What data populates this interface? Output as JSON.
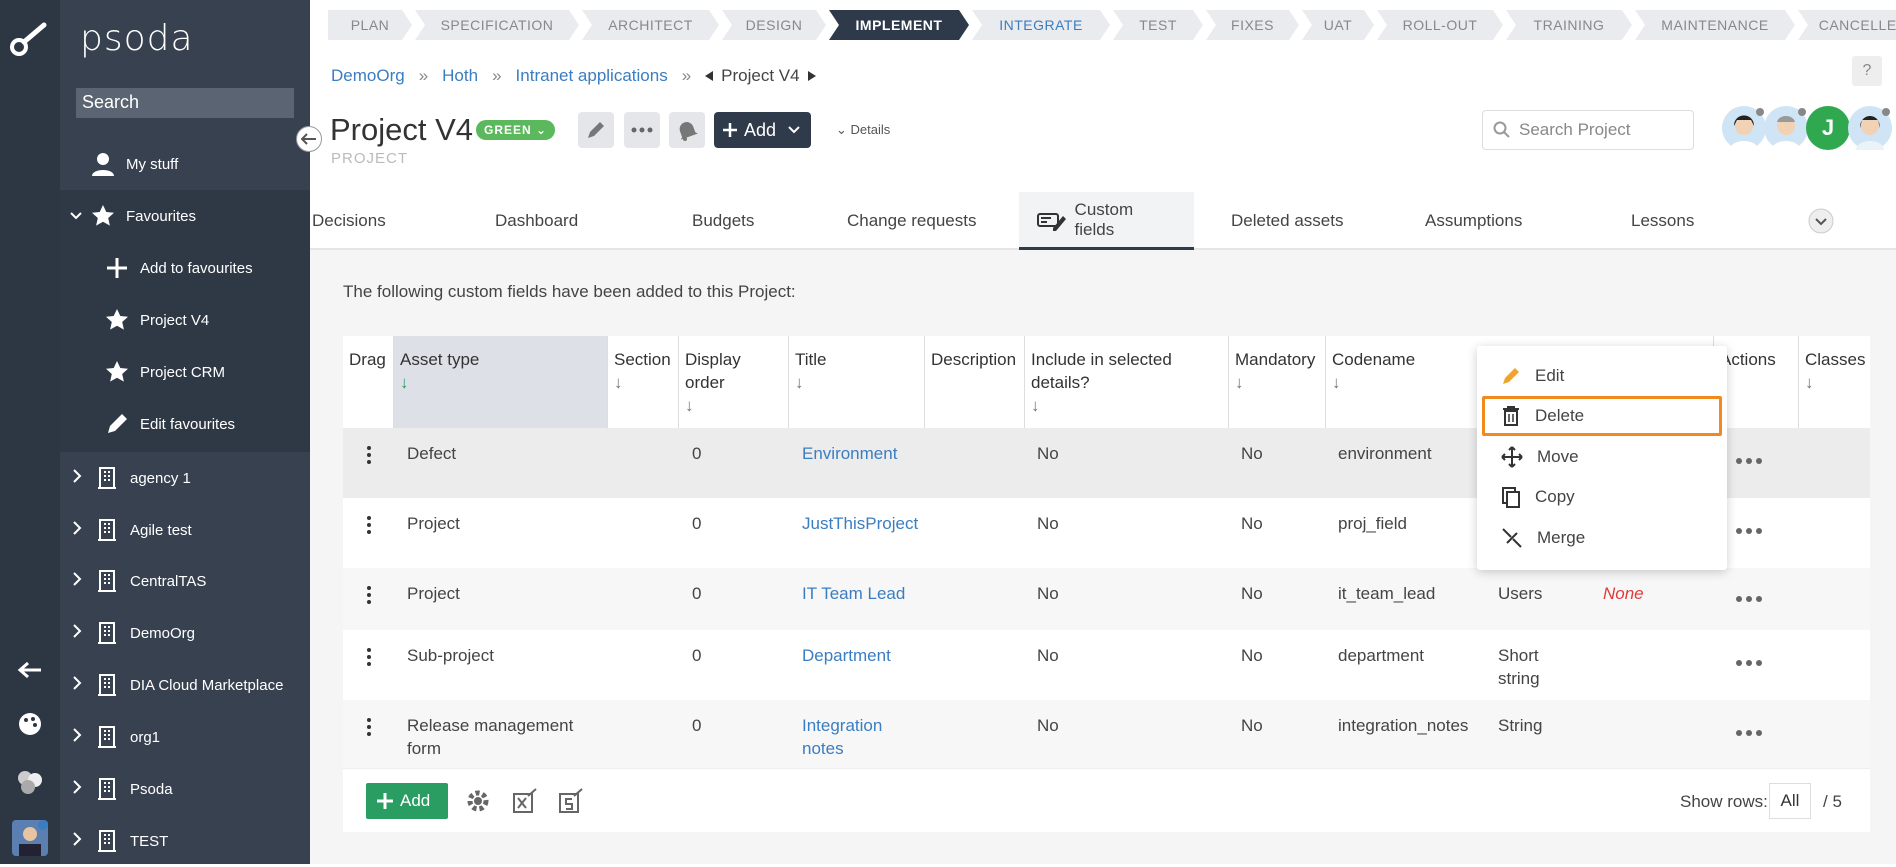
{
  "app": {
    "logo": "psoda"
  },
  "sidebar": {
    "search_placeholder": "Search",
    "items": [
      {
        "label": "My stuff"
      },
      {
        "label": "Favourites"
      },
      {
        "label": "Add to favourites"
      },
      {
        "label": "Project V4"
      },
      {
        "label": "Project CRM"
      },
      {
        "label": "Edit favourites"
      },
      {
        "label": "agency 1"
      },
      {
        "label": "Agile test"
      },
      {
        "label": "CentralTAS"
      },
      {
        "label": "DemoOrg"
      },
      {
        "label": "DIA Cloud Marketplace"
      },
      {
        "label": "org1"
      },
      {
        "label": "Psoda"
      },
      {
        "label": "TEST"
      }
    ]
  },
  "stages": [
    "PLAN",
    "SPECIFICATION",
    "ARCHITECT",
    "DESIGN",
    "IMPLEMENT",
    "INTEGRATE",
    "TEST",
    "FIXES",
    "UAT",
    "ROLL-OUT",
    "TRAINING",
    "MAINTENANCE",
    "CANCELLED"
  ],
  "breadcrumb": {
    "items": [
      "DemoOrg",
      "Hoth",
      "Intranet applications"
    ],
    "sep": "»",
    "current": "Project V4"
  },
  "header": {
    "title": "Project V4",
    "status": "GREEN",
    "subtitle": "PROJECT",
    "add_label": "Add",
    "details_label": "Details",
    "search_placeholder": "Search Project",
    "help": "?",
    "avatar_letter": "J"
  },
  "tabs": [
    "Decisions",
    "Dashboard",
    "Budgets",
    "Change requests",
    "Custom fields",
    "Deleted assets",
    "Assumptions",
    "Lessons"
  ],
  "intro": "The following custom fields have been added to this Project:",
  "table": {
    "headers": {
      "drag": "Drag",
      "asset_type": "Asset type",
      "section": "Section",
      "display_order_1": "Display",
      "display_order_2": "order",
      "title": "Title",
      "description": "Description",
      "include_1": "Include in selected",
      "include_2": "details?",
      "mandatory": "Mandatory",
      "codename": "Codename",
      "actions": "Actions",
      "classes": "Classes"
    },
    "sort_arrow": "↓",
    "rows": [
      {
        "asset_type": "Defect",
        "order": "0",
        "title": "Environment",
        "include": "No",
        "mandatory": "No",
        "codename": "environment"
      },
      {
        "asset_type": "Project",
        "order": "0",
        "title": "JustThisProject",
        "include": "No",
        "mandatory": "No",
        "codename": "proj_field"
      },
      {
        "asset_type": "Project",
        "order": "0",
        "title": "IT Team Lead",
        "include": "No",
        "mandatory": "No",
        "codename": "it_team_lead",
        "type": "Users",
        "classes_val": "None"
      },
      {
        "asset_type": "Sub-project",
        "order": "0",
        "title": "Department",
        "include": "No",
        "mandatory": "No",
        "codename": "department",
        "type_1": "Short",
        "type_2": "string"
      },
      {
        "asset_type_1": "Release management",
        "asset_type_2": "form",
        "order": "0",
        "title_1": "Integration",
        "title_2": "notes",
        "include": "No",
        "mandatory": "No",
        "codename": "integration_notes",
        "type": "String"
      }
    ]
  },
  "context_menu": [
    "Edit",
    "Delete",
    "Move",
    "Copy",
    "Merge"
  ],
  "footer": {
    "add_label": "Add",
    "show_rows_label": "Show rows:",
    "show_rows_value": "All",
    "pages": "/ 5"
  },
  "colors": {
    "accent": "#f08a1c",
    "link": "#3a7dc1",
    "green": "#2a9d62",
    "dark": "#2f3a4a"
  }
}
